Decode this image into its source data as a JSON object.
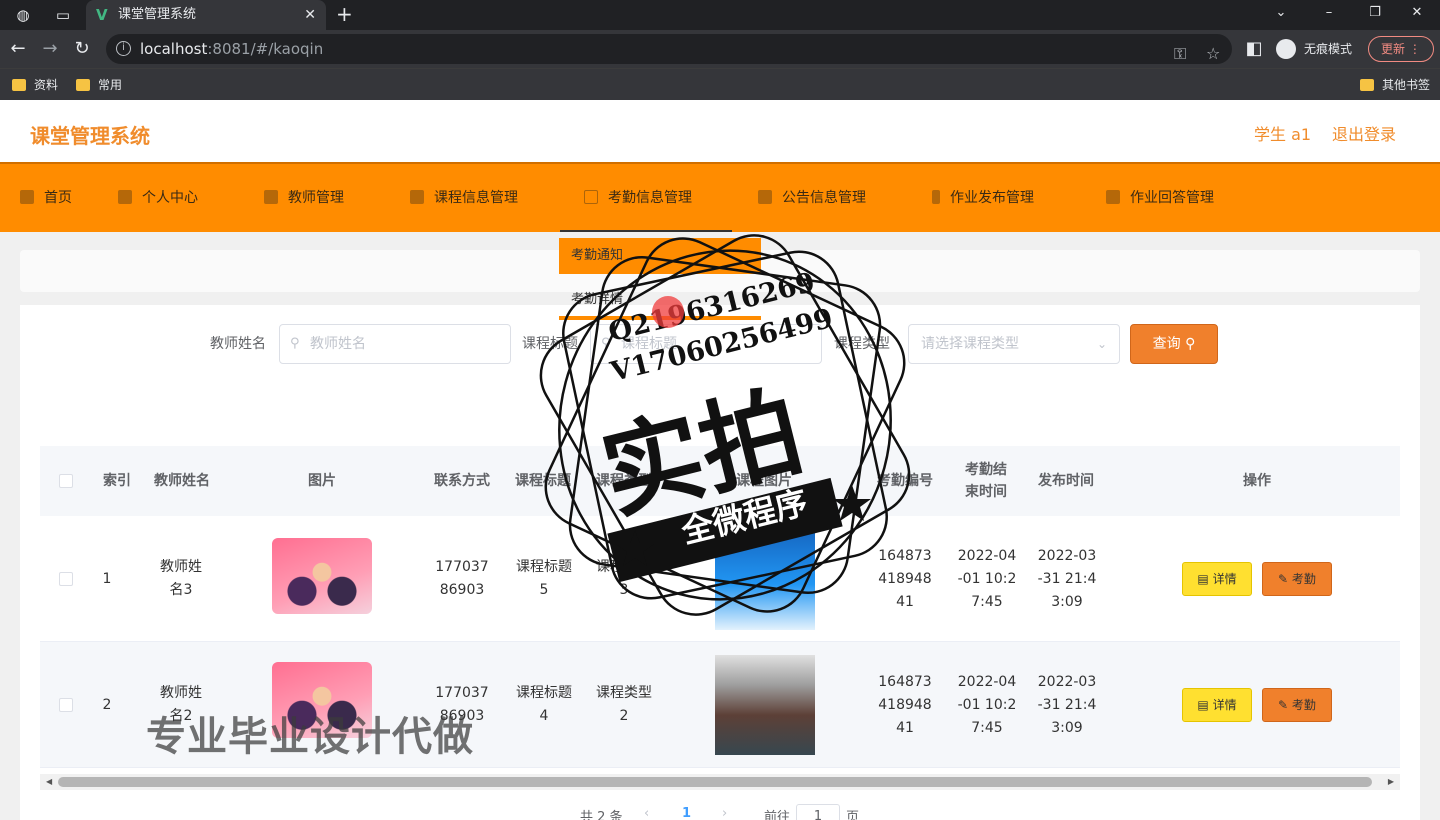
{
  "browser": {
    "tab_title": "课堂管理系统",
    "url_host": "localhost",
    "url_port_path": ":8081/#/kaoqin",
    "incognito_label": "无痕模式",
    "update_label": "更新",
    "bookmarks": [
      "资料",
      "常用"
    ],
    "other_bookmarks": "其他书签"
  },
  "header": {
    "title": "课堂管理系统",
    "user": "学生 a1",
    "logout": "退出登录"
  },
  "nav": {
    "items": [
      "首页",
      "个人中心",
      "教师管理",
      "课程信息管理",
      "考勤信息管理",
      "公告信息管理",
      "作业发布管理",
      "作业回答管理"
    ],
    "active": "考勤信息管理",
    "dropdown": [
      "考勤通知",
      "考勤详情"
    ]
  },
  "search": {
    "teacher_label": "教师姓名",
    "teacher_placeholder": "教师姓名",
    "title_label": "课程标题",
    "title_placeholder": "课程标题",
    "type_label": "课程类型",
    "type_placeholder": "请选择课程类型",
    "query_button": "查询"
  },
  "table": {
    "columns": [
      "索引",
      "教师姓名",
      "图片",
      "联系方式",
      "课程标题",
      "课程类型",
      "课程图片",
      "考勤编号",
      "考勤结束时间",
      "发布时间",
      "操作"
    ],
    "rows": [
      {
        "index": "1",
        "teacher": "教师姓名3",
        "phone": "17703786903",
        "course_title": "课程标题5",
        "course_type": "课程类型3",
        "kaoqin_no": "16487341894841",
        "end_time": "2022-04-01 10:27:45",
        "publish_time": "2022-03-31 21:43:09"
      },
      {
        "index": "2",
        "teacher": "教师姓名2",
        "phone": "17703786903",
        "course_title": "课程标题4",
        "course_type": "课程类型2",
        "kaoqin_no": "16487341894841",
        "end_time": "2022-04-01 10:27:45",
        "publish_time": "2022-03-31 21:43:09"
      }
    ],
    "detail_button": "详情",
    "kaoqin_button": "考勤"
  },
  "pagination": {
    "total": "共 2 条",
    "current_page": "1",
    "goto_label": "前往",
    "goto_value": "1",
    "page_suffix": "页"
  },
  "watermark": {
    "qq": "Q2196316269",
    "vx": "V17060256499",
    "main": "实拍",
    "banner": "全微程序",
    "bottom": "专业毕业设计代做"
  }
}
